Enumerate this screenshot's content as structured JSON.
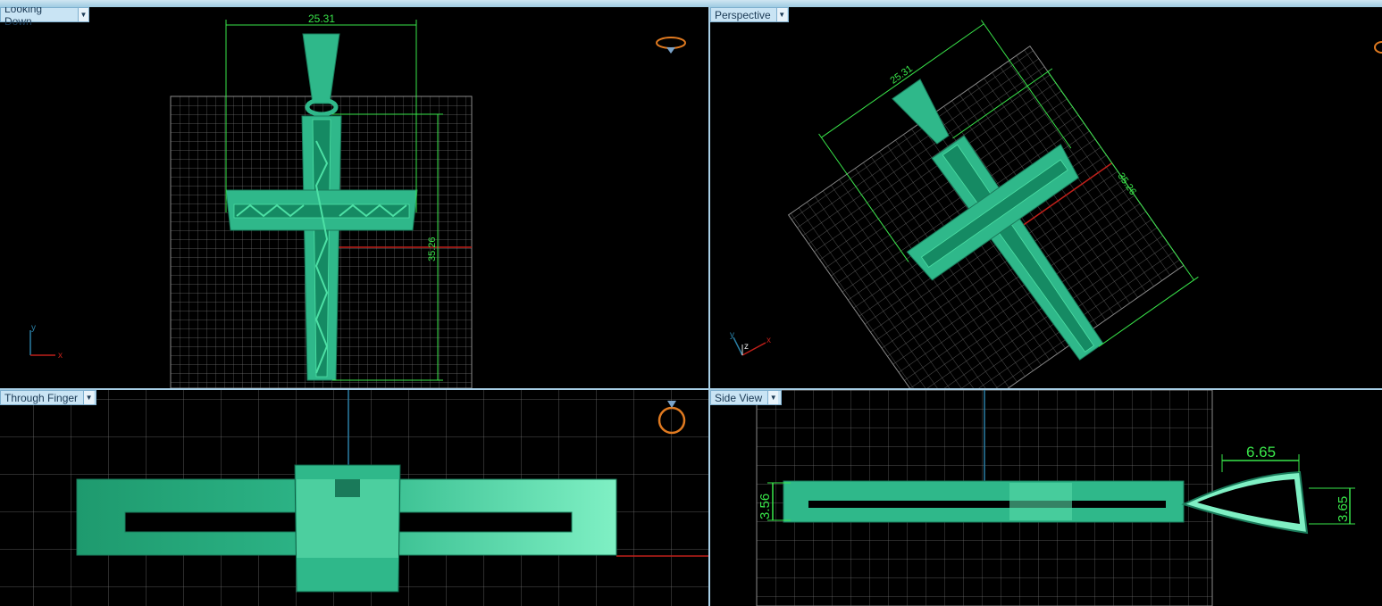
{
  "viewports": {
    "top_left": {
      "label": "Looking Down",
      "dimension_width": "25.31",
      "dimension_height": "35.26",
      "axis_x": "x",
      "axis_y": "y"
    },
    "top_right": {
      "label": "Perspective",
      "dimension_width": "25.31",
      "dimension_height": "35.26",
      "axis_x": "x",
      "axis_y": "y",
      "axis_z": "z"
    },
    "bottom_left": {
      "label": "Through Finger"
    },
    "bottom_right": {
      "label": "Side View",
      "dimension_bail_length": "6.65",
      "dimension_thickness": "3.56",
      "dimension_bail_height": "3.65"
    }
  },
  "colors": {
    "model": "#2fb88a",
    "model_light": "#7ff0c4",
    "dimension": "#39e64a",
    "grid": "#6e6e6e",
    "axis_x": "#c0201a",
    "axis_y": "#2a7fa5",
    "label_bg": "#c9e4f4",
    "separator": "#a8cfe6"
  },
  "icons": {
    "view_cube_icon": "ring-orientation-icon",
    "dropdown_icon": "chevron-down-icon"
  }
}
